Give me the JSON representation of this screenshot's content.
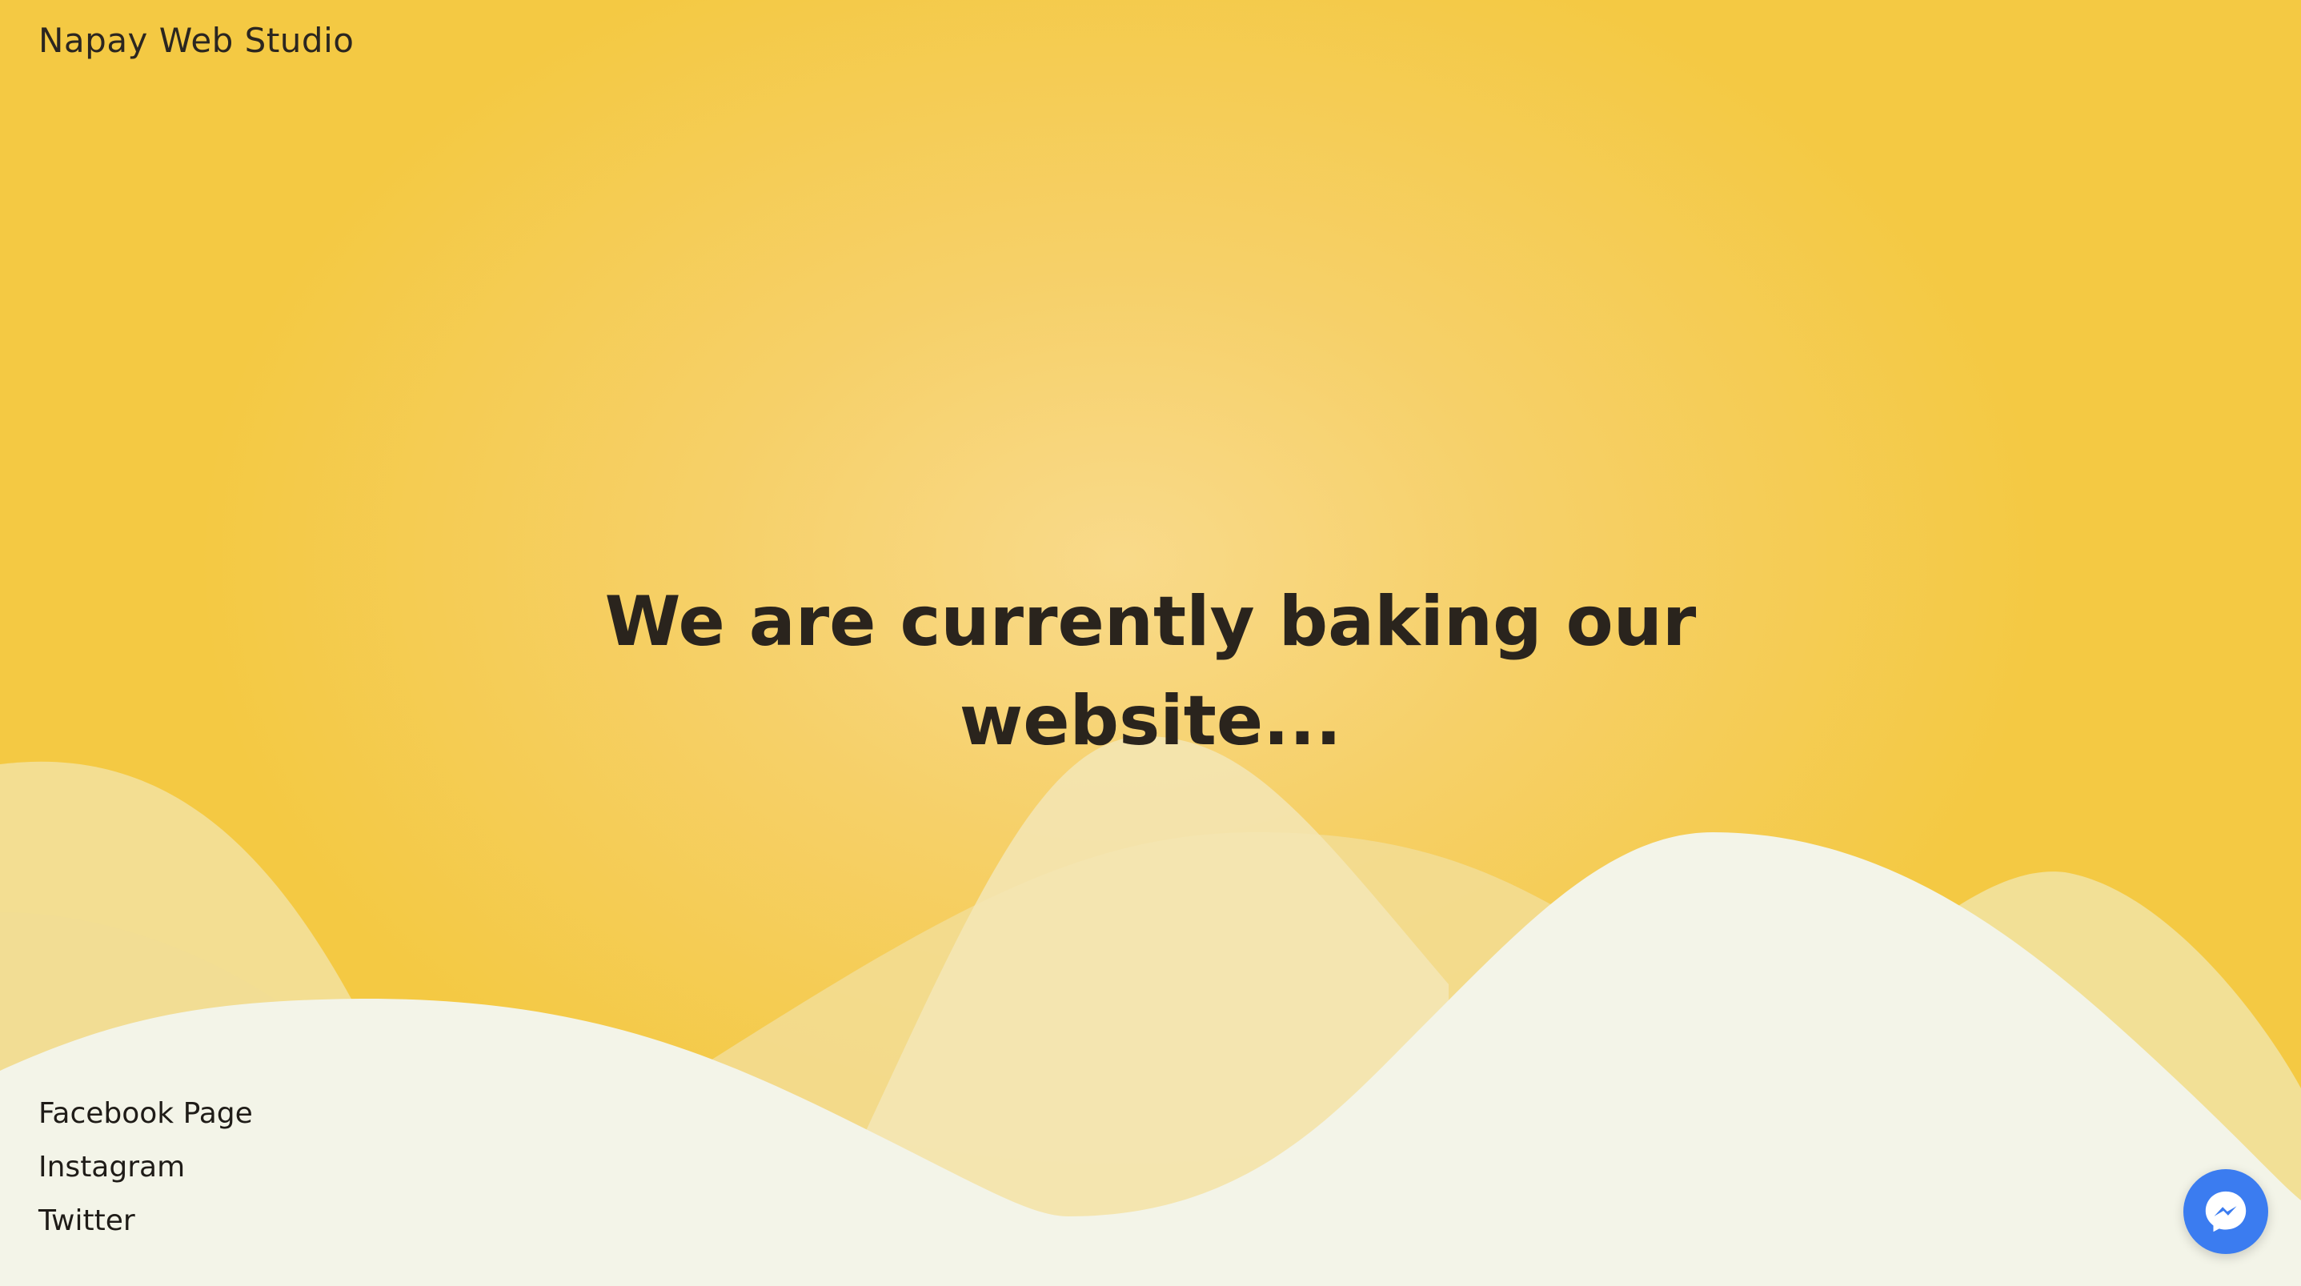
{
  "header": {
    "brand": "Napay Web Studio"
  },
  "hero": {
    "line1": "We are currently baking our",
    "line2": "website..."
  },
  "social": {
    "links": [
      {
        "label": "Facebook Page"
      },
      {
        "label": "Instagram"
      },
      {
        "label": "Twitter"
      }
    ]
  },
  "chat": {
    "icon": "messenger-icon"
  },
  "colors": {
    "background": "#f4c943",
    "background_center": "#f9da8a",
    "wave_front": "#f3f4e8",
    "wave_back": "#f2e4a6",
    "text_dark": "#2a241d",
    "messenger": "#3b7cf0"
  }
}
